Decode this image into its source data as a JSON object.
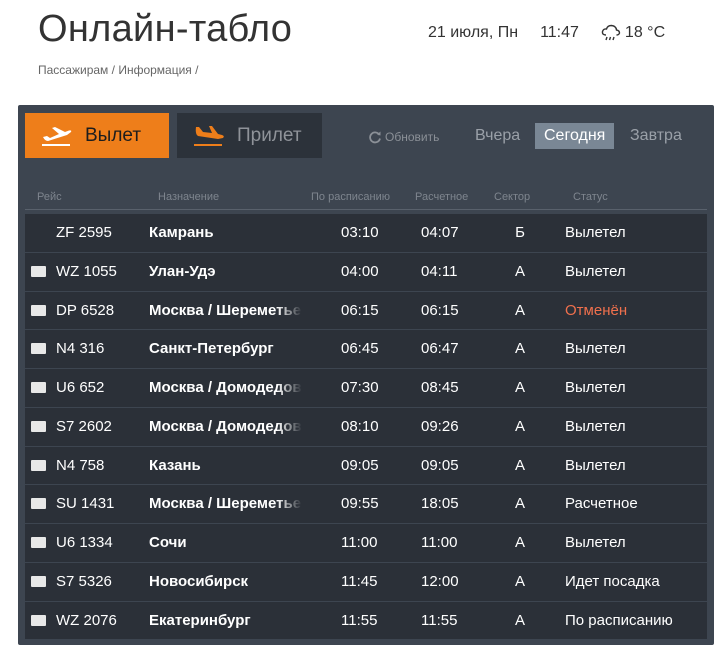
{
  "header": {
    "title": "Онлайн-табло",
    "date": "21 июля, Пн",
    "time": "11:47",
    "temperature": "18 °C"
  },
  "breadcrumb": [
    "Пассажирам",
    "Информация"
  ],
  "board": {
    "tabs": {
      "departure": "Вылет",
      "arrival": "Прилет"
    },
    "refresh_label": "Обновить",
    "days": {
      "yesterday": "Вчера",
      "today": "Сегодня",
      "tomorrow": "Завтра"
    },
    "columns": {
      "flight": "Рейс",
      "destination": "Назначение",
      "scheduled": "По расписанию",
      "estimated": "Расчетное",
      "sector": "Сектор",
      "status": "Статус"
    },
    "flights": [
      {
        "logo": "",
        "flight": "ZF 2595",
        "destination": "Камрань",
        "scheduled": "03:10",
        "estimated": "04:07",
        "sector": "Б",
        "status": "Вылетел"
      },
      {
        "logo": "wz",
        "flight": "WZ 1055",
        "destination": "Улан-Удэ",
        "scheduled": "04:00",
        "estimated": "04:11",
        "sector": "А",
        "status": "Вылетел"
      },
      {
        "logo": "dp",
        "flight": "DP 6528",
        "destination": "Москва / Шереметьево",
        "scheduled": "06:15",
        "estimated": "06:15",
        "sector": "А",
        "status": "Отменён",
        "cancelled": true
      },
      {
        "logo": "n4",
        "flight": "N4 316",
        "destination": "Санкт-Петербург",
        "scheduled": "06:45",
        "estimated": "06:47",
        "sector": "А",
        "status": "Вылетел"
      },
      {
        "logo": "u6",
        "flight": "U6 652",
        "destination": "Москва / Домодедово",
        "scheduled": "07:30",
        "estimated": "08:45",
        "sector": "А",
        "status": "Вылетел"
      },
      {
        "logo": "s7",
        "flight": "S7 2602",
        "destination": "Москва / Домодедово",
        "scheduled": "08:10",
        "estimated": "09:26",
        "sector": "А",
        "status": "Вылетел"
      },
      {
        "logo": "n4",
        "flight": "N4 758",
        "destination": "Казань",
        "scheduled": "09:05",
        "estimated": "09:05",
        "sector": "А",
        "status": "Вылетел"
      },
      {
        "logo": "su",
        "flight": "SU 1431",
        "destination": "Москва / Шереметьево",
        "scheduled": "09:55",
        "estimated": "18:05",
        "sector": "А",
        "status": "Расчетное"
      },
      {
        "logo": "u6",
        "flight": "U6 1334",
        "destination": "Сочи",
        "scheduled": "11:00",
        "estimated": "11:00",
        "sector": "А",
        "status": "Вылетел"
      },
      {
        "logo": "s7",
        "flight": "S7 5326",
        "destination": "Новосибирск",
        "scheduled": "11:45",
        "estimated": "12:00",
        "sector": "А",
        "status": "Идет посадка"
      },
      {
        "logo": "wz",
        "flight": "WZ 2076",
        "destination": "Екатеринбург",
        "scheduled": "11:55",
        "estimated": "11:55",
        "sector": "А",
        "status": "По расписанию"
      }
    ]
  },
  "colors": {
    "accent": "#ee7e1a",
    "board_bg": "#3d4550",
    "row_bg": "#2b3038",
    "cancelled": "#f0704d",
    "today_bg": "#7a8795"
  }
}
